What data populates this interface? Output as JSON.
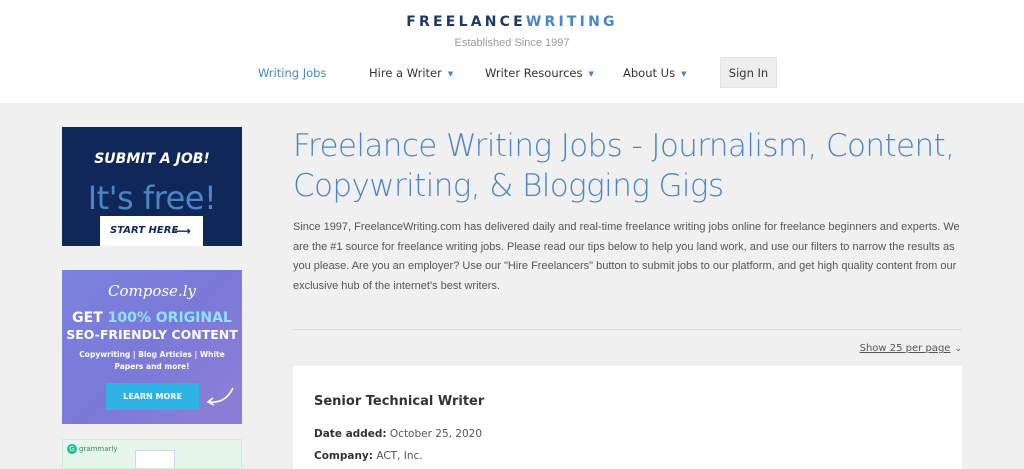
{
  "header": {
    "logo_part1": "FREELANCE",
    "logo_part2": "WRITING",
    "tagline": "Established Since 1997"
  },
  "nav": {
    "items": [
      {
        "label": "Writing Jobs",
        "active": true
      },
      {
        "label": "Hire a Writer",
        "dropdown": true
      },
      {
        "label": "Writer Resources",
        "dropdown": true
      },
      {
        "label": "About Us",
        "dropdown": true
      }
    ],
    "signin_label": "Sign In"
  },
  "ads": {
    "submit_job": {
      "title": "SUBMIT A JOB!",
      "subtitle": "It's free!",
      "button": "START HERE"
    },
    "composely": {
      "logo": "Compose.ly",
      "line1_prefix": "GET ",
      "line1_highlight": "100% ORIGINAL",
      "line2": "SEO-FRIENDLY CONTENT",
      "subtext": "Copywriting | Blog Articles | White Papers and more!",
      "button": "LEARN MORE"
    },
    "grammarly": {
      "logo": "grammarly"
    }
  },
  "main": {
    "title": "Freelance Writing Jobs - Journalism, Content, Copywriting, & Blogging Gigs",
    "intro": "Since 1997, FreelanceWriting.com has delivered daily and real-time freelance writing jobs online for freelance beginners and experts. We are the #1 source for freelance writing jobs. Please read our tips below to help you land work, and use our filters to narrow the results as you please. Are you an employer? Use our \"Hire Freelancers\" button to submit jobs to our platform, and get high quality content from our exclusive hub of the internet's best writers.",
    "per_page_label": "Show 25 per page"
  },
  "job": {
    "title": "Senior Technical Writer",
    "date_label": "Date added:",
    "date_value": "October 25, 2020",
    "company_label": "Company:",
    "company_value": "ACT, Inc."
  },
  "colors": {
    "brand_dark": "#1d3a66",
    "brand_blue": "#4a86c5",
    "ad_navy": "#10275a",
    "ad_purple": "#7d82df",
    "ad_cyan": "#2fb3e4"
  }
}
